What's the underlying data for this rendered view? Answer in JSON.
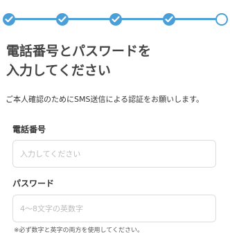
{
  "theme": {
    "accent": "#4a9fd8",
    "text": "#333333",
    "field_border": "#dddddd",
    "placeholder": "#bbbbbb"
  },
  "stepper": {
    "total_steps": 5,
    "completed_steps": 4,
    "current_step": 5,
    "icons": [
      "check-icon",
      "check-icon",
      "check-icon",
      "check-icon",
      "empty-circle"
    ]
  },
  "title": "電話番号とパスワードを\n入力してください",
  "intro": "ご本人確認のためにSMS送信による認証をお願いします。",
  "phone": {
    "label": "電話番号",
    "value": "",
    "placeholder": "入力してください"
  },
  "password": {
    "label": "パスワード",
    "value": "",
    "placeholder": "4〜8文字の英数字",
    "hint": "※必ず数字と英字の両方を使用してください。"
  }
}
